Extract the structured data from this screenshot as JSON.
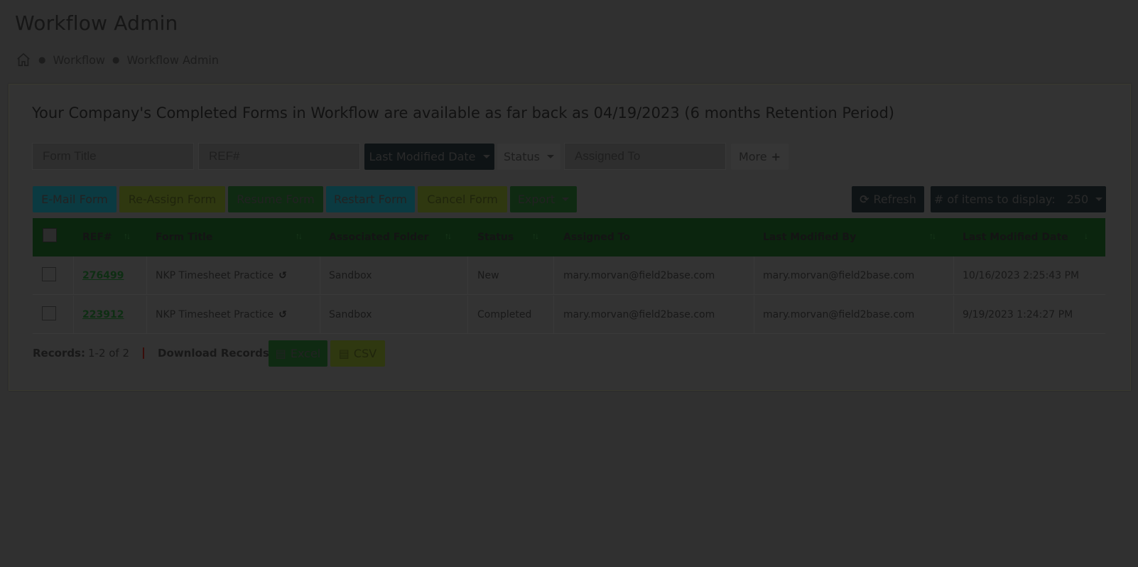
{
  "header": {
    "title": "Workflow Admin",
    "breadcrumb": [
      "Workflow",
      "Workflow Admin"
    ]
  },
  "notice": "Your Company's Completed Forms in Workflow are available as far back as 04/19/2023 (6 months Retention Period)",
  "filters": {
    "form_title_placeholder": "Form Title",
    "ref_placeholder": "REF#",
    "last_modified_date": "Last Modified Date",
    "status": "Status",
    "assigned_to_placeholder": "Assigned To",
    "more": "More"
  },
  "actions": {
    "email": "E-Mail Form",
    "reassign": "Re-Assign Form",
    "resume": "Resume Form",
    "restart": "Restart Form",
    "cancel": "Cancel Form",
    "export": "Export",
    "refresh": "Refresh",
    "items_label": "# of items to display:",
    "items_value": "250"
  },
  "table": {
    "columns": [
      "REF#",
      "Form Title",
      "Associated Folder",
      "Status",
      "Assigned To",
      "Last Modified By",
      "Last Modified Date"
    ],
    "rows": [
      {
        "ref": "276499",
        "title": "NKP Timesheet Practice",
        "folder": "Sandbox",
        "status": "New",
        "assigned": "mary.morvan@field2base.com",
        "modified_by": "mary.morvan@field2base.com",
        "modified_date": "10/16/2023 2:25:43 PM"
      },
      {
        "ref": "223912",
        "title": "NKP Timesheet Practice",
        "folder": "Sandbox",
        "status": "Completed",
        "assigned": "mary.morvan@field2base.com",
        "modified_by": "mary.morvan@field2base.com",
        "modified_date": "9/19/2023 1:24:27 PM"
      }
    ]
  },
  "footer": {
    "records_label": "Records:",
    "records_value": "1-2 of 2",
    "download_label": "Download Records",
    "excel": "Excel",
    "csv": "CSV"
  },
  "colors": {
    "teal": "#0b3a41",
    "olive": "#2f3810",
    "dark_green": "#0f2a12",
    "black": "#0e1315",
    "header_green": "#0b250e"
  }
}
